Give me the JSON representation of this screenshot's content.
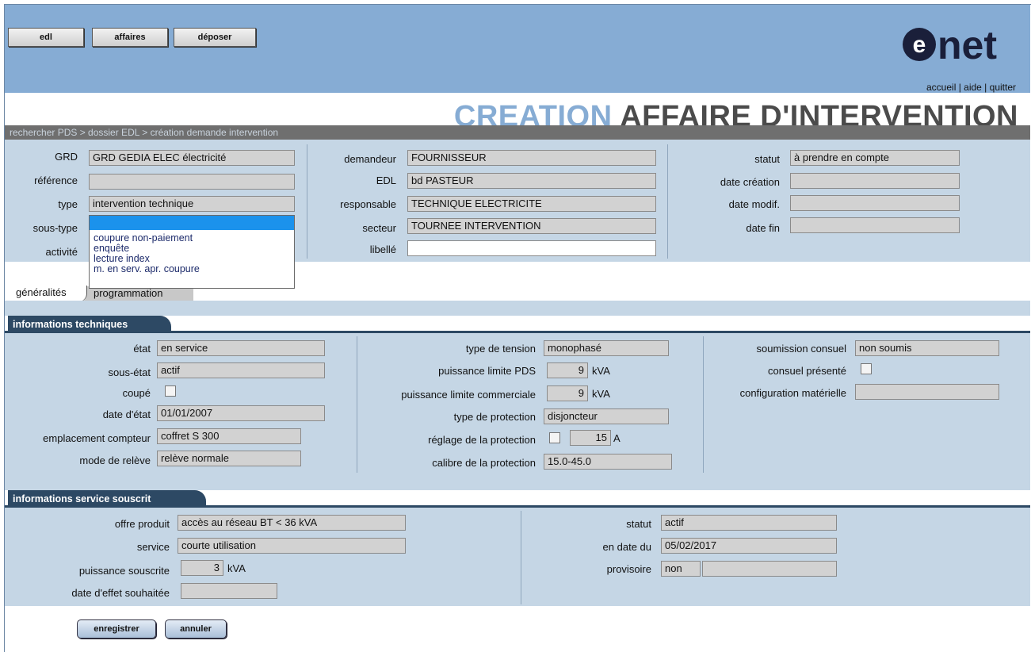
{
  "nav": {
    "edl": "edl",
    "affaires": "affaires",
    "deposer": "déposer"
  },
  "logo": {
    "text": "enet",
    "accent_color": "#1a1f3a"
  },
  "toplinks": {
    "accueil": "accueil",
    "aide": "aide",
    "quitter": "quitter",
    "sep": " | "
  },
  "page_title": {
    "part1": "CREATION",
    "part2": "AFFAIRE D'INTERVENTION"
  },
  "breadcrumb": "rechercher PDS > dossier EDL > création demande intervention",
  "header_fields": {
    "grd": {
      "label": "GRD",
      "value": "GRD GEDIA ELEC électricité"
    },
    "reference": {
      "label": "référence",
      "value": ""
    },
    "type": {
      "label": "type",
      "value": "intervention technique"
    },
    "sous_type": {
      "label": "sous-type",
      "value": ""
    },
    "activite": {
      "label": "activité"
    },
    "demandeur": {
      "label": "demandeur",
      "value": "FOURNISSEUR"
    },
    "edl": {
      "label": "EDL",
      "value": "bd PASTEUR"
    },
    "responsable": {
      "label": "responsable",
      "value": "TECHNIQUE ELECTRICITE"
    },
    "secteur": {
      "label": "secteur",
      "value": "TOURNEE INTERVENTION"
    },
    "libelle": {
      "label": "libellé",
      "value": ""
    },
    "statut": {
      "label": "statut",
      "value": "à prendre en compte"
    },
    "date_creation": {
      "label": "date création",
      "value": ""
    },
    "date_modif": {
      "label": "date modif.",
      "value": ""
    },
    "date_fin": {
      "label": "date fin",
      "value": ""
    }
  },
  "sous_type_options": [
    "coupure non-paiement",
    "enquête",
    "lecture index",
    "m. en serv. apr. coupure"
  ],
  "tabs": {
    "generalites": "généralités",
    "programmation": "programmation"
  },
  "tech": {
    "title": "informations techniques",
    "etat": {
      "label": "état",
      "value": "en service"
    },
    "sous_etat": {
      "label": "sous-état",
      "value": "actif"
    },
    "coupe": {
      "label": "coupé"
    },
    "date_etat": {
      "label": "date d'état",
      "value": "01/01/2007"
    },
    "emplacement": {
      "label": "emplacement compteur",
      "value": "coffret S 300"
    },
    "mode_releve": {
      "label": "mode de relève",
      "value": "relève normale"
    },
    "type_tension": {
      "label": "type de tension",
      "value": "monophasé"
    },
    "puissance_pds": {
      "label": "puissance limite PDS",
      "value": "9",
      "unit": "kVA"
    },
    "puissance_com": {
      "label": "puissance limite commerciale",
      "value": "9",
      "unit": "kVA"
    },
    "type_protection": {
      "label": "type de protection",
      "value": "disjoncteur"
    },
    "reglage": {
      "label": "réglage de la protection",
      "value": "15",
      "unit": "A"
    },
    "calibre": {
      "label": "calibre de la protection",
      "value": "15.0-45.0"
    },
    "soumission": {
      "label": "soumission consuel",
      "value": "non soumis"
    },
    "consuel_presente": {
      "label": "consuel présenté"
    },
    "config": {
      "label": "configuration matérielle",
      "value": ""
    }
  },
  "service": {
    "title": "informations service souscrit",
    "offre": {
      "label": "offre produit",
      "value": "accès au réseau BT < 36 kVA"
    },
    "service": {
      "label": "service",
      "value": "courte utilisation"
    },
    "puissance": {
      "label": "puissance souscrite",
      "value": "3",
      "unit": "kVA"
    },
    "date_effet": {
      "label": "date d'effet souhaitée",
      "value": ""
    },
    "statut": {
      "label": "statut",
      "value": "actif"
    },
    "en_date_du": {
      "label": "en date du",
      "value": "05/02/2017"
    },
    "provisoire": {
      "label": "provisoire",
      "value": "non",
      "value2": ""
    }
  },
  "actions": {
    "enregistrer": "enregistrer",
    "annuler": "annuler"
  },
  "colors": {
    "header_bg": "#86acd4",
    "panel_bg": "#c5d6e5",
    "section_header": "#2d4964",
    "dropdown_selected": "#1b92ec"
  }
}
